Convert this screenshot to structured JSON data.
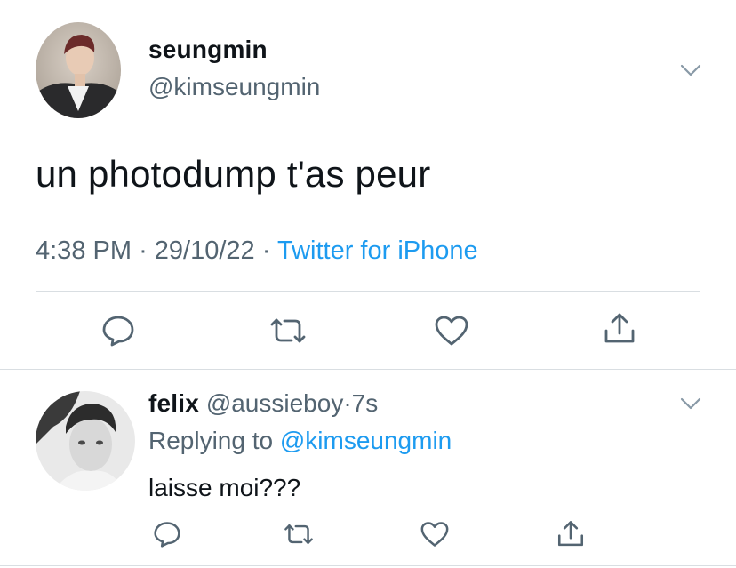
{
  "main_tweet": {
    "display_name": "seungmin",
    "handle": "@kimseungmin",
    "text": "un photodump t'as peur",
    "time": "4:38 PM",
    "date": "29/10/22",
    "separator": "·",
    "source": "Twitter for iPhone"
  },
  "reply_tweet": {
    "display_name": "felix",
    "handle": "@aussieboy",
    "separator": "·",
    "age": "7s",
    "replying_prefix": "Replying to",
    "replying_to": "@kimseungmin",
    "text": "laisse moi???"
  },
  "icons": {
    "reply": "reply-icon",
    "retweet": "retweet-icon",
    "like": "like-icon",
    "share": "share-icon",
    "more": "chevron-down-icon"
  },
  "colors": {
    "link": "#1d9bf0",
    "muted": "#536471",
    "text": "#0f1419",
    "divider": "#d9dee2"
  }
}
